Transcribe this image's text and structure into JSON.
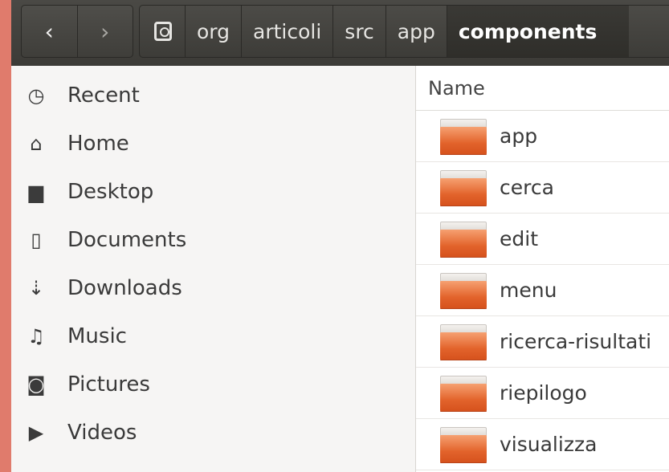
{
  "navigation": {
    "back_glyph": "‹",
    "forward_glyph": "›"
  },
  "breadcrumb": [
    {
      "label": "org"
    },
    {
      "label": "articoli"
    },
    {
      "label": "src"
    },
    {
      "label": "app"
    },
    {
      "label": "components",
      "active": true
    }
  ],
  "sidebar": {
    "items": [
      {
        "label": "Recent",
        "icon": "clock-icon",
        "glyph": "◷"
      },
      {
        "label": "Home",
        "icon": "home-icon",
        "glyph": "⌂"
      },
      {
        "label": "Desktop",
        "icon": "folder-icon",
        "glyph": "▆"
      },
      {
        "label": "Documents",
        "icon": "document-icon",
        "glyph": "▯"
      },
      {
        "label": "Downloads",
        "icon": "download-icon",
        "glyph": "⇣"
      },
      {
        "label": "Music",
        "icon": "music-icon",
        "glyph": "♫"
      },
      {
        "label": "Pictures",
        "icon": "camera-icon",
        "glyph": "◙"
      },
      {
        "label": "Videos",
        "icon": "video-icon",
        "glyph": "▶"
      }
    ]
  },
  "file_list": {
    "column_name": "Name",
    "rows": [
      {
        "name": "app"
      },
      {
        "name": "cerca"
      },
      {
        "name": "edit"
      },
      {
        "name": "menu"
      },
      {
        "name": "ricerca-risultati"
      },
      {
        "name": "riepilogo"
      },
      {
        "name": "visualizza"
      }
    ]
  },
  "colors": {
    "desktop_background": "#e07b6c",
    "headerbar": "#3c3b37",
    "folder_orange": "#e2632b"
  }
}
